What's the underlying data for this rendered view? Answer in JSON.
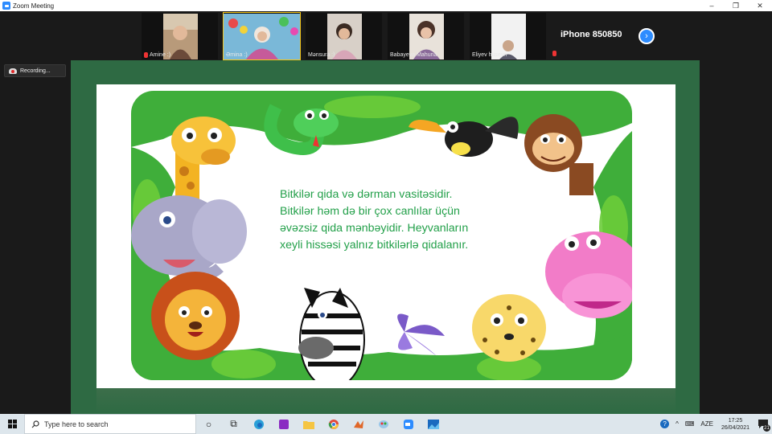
{
  "window": {
    "title": "Zoom Meeting",
    "minimize": "–",
    "maximize": "❐",
    "close": "✕"
  },
  "participants": [
    {
      "name": "Amine :)",
      "muted": true,
      "active": false
    },
    {
      "name": "Əmina :)",
      "muted": false,
      "active": true
    },
    {
      "name": "Mənsura :)",
      "muted": false,
      "active": false
    },
    {
      "name": "Babayeva Mahuna",
      "muted": false,
      "active": false
    },
    {
      "name": "Eliyev hüseyn",
      "muted": false,
      "active": false
    }
  ],
  "name_only_tile": {
    "name": "iPhone 850850",
    "muted": true
  },
  "strip_next": "›",
  "recording": {
    "label": "Recording..."
  },
  "slide": {
    "lines": [
      "Bitkilər qida və dərman vasitəsidir.",
      "Bitkilər həm də bir çox canlılar üçün",
      "əvəzsiz qida mənbəyidir. Heyvanların",
      "xeyli hissəsi yalnız bitkilərlə qidalanır."
    ],
    "text_color": "#23a04a"
  },
  "taskbar": {
    "search_placeholder": "Type here to search",
    "language": "AZE",
    "time": "17:25",
    "date": "26/04/2021",
    "notification_count": "21",
    "help": "?",
    "tray_chevron": "^"
  },
  "colors": {
    "share_bg": "#2e6a43",
    "zoom_blue": "#2d8cff",
    "active_border": "#f5c518"
  }
}
